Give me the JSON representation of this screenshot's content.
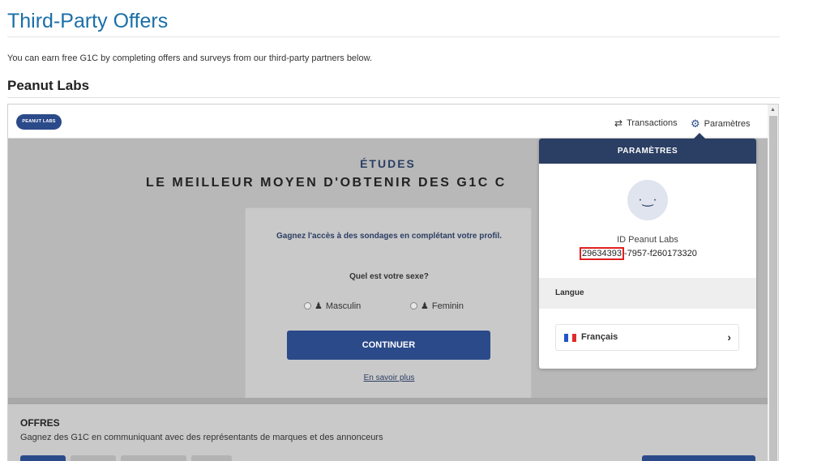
{
  "page": {
    "title": "Third-Party Offers",
    "intro": "You can earn free G1C by completing offers and surveys from our third-party partners below.",
    "section_title": "Peanut Labs"
  },
  "peanut": {
    "logo_text": "PEANUT LABS",
    "header": {
      "transactions_label": "Transactions",
      "settings_label": "Paramètres"
    },
    "hero": {
      "kicker": "ÉTUDES",
      "slogan": "LE MEILLEUR MOYEN D'OBTENIR DES G1C C"
    },
    "profile_card": {
      "prompt": "Gagnez l'accès à des sondages en complétant votre profil.",
      "question": "Quel est votre sexe?",
      "option_male": "Masculin",
      "option_female": "Feminin",
      "continue_label": "CONTINUER",
      "learn_more": "En savoir plus"
    },
    "offers": {
      "title": "OFFRES",
      "subtitle": "Gagnez des G1C en communiquant avec des représentants de marques et des annonceurs"
    },
    "settings_popover": {
      "title": "PARAMÈTRES",
      "id_label": "ID Peanut Labs",
      "id_highlighted": "29634393",
      "id_rest": "-7957-f260173320",
      "language_heading": "Langue",
      "language_value": "Français"
    },
    "colors": {
      "brand_navy": "#2b3e63",
      "button_blue": "#2b4a8a",
      "title_blue": "#1a6fa8",
      "highlight_red": "#e02020"
    },
    "icons": {
      "transactions": "swap-arrows-icon",
      "settings": "gear-icon",
      "language_next": "chevron-right-icon"
    }
  }
}
